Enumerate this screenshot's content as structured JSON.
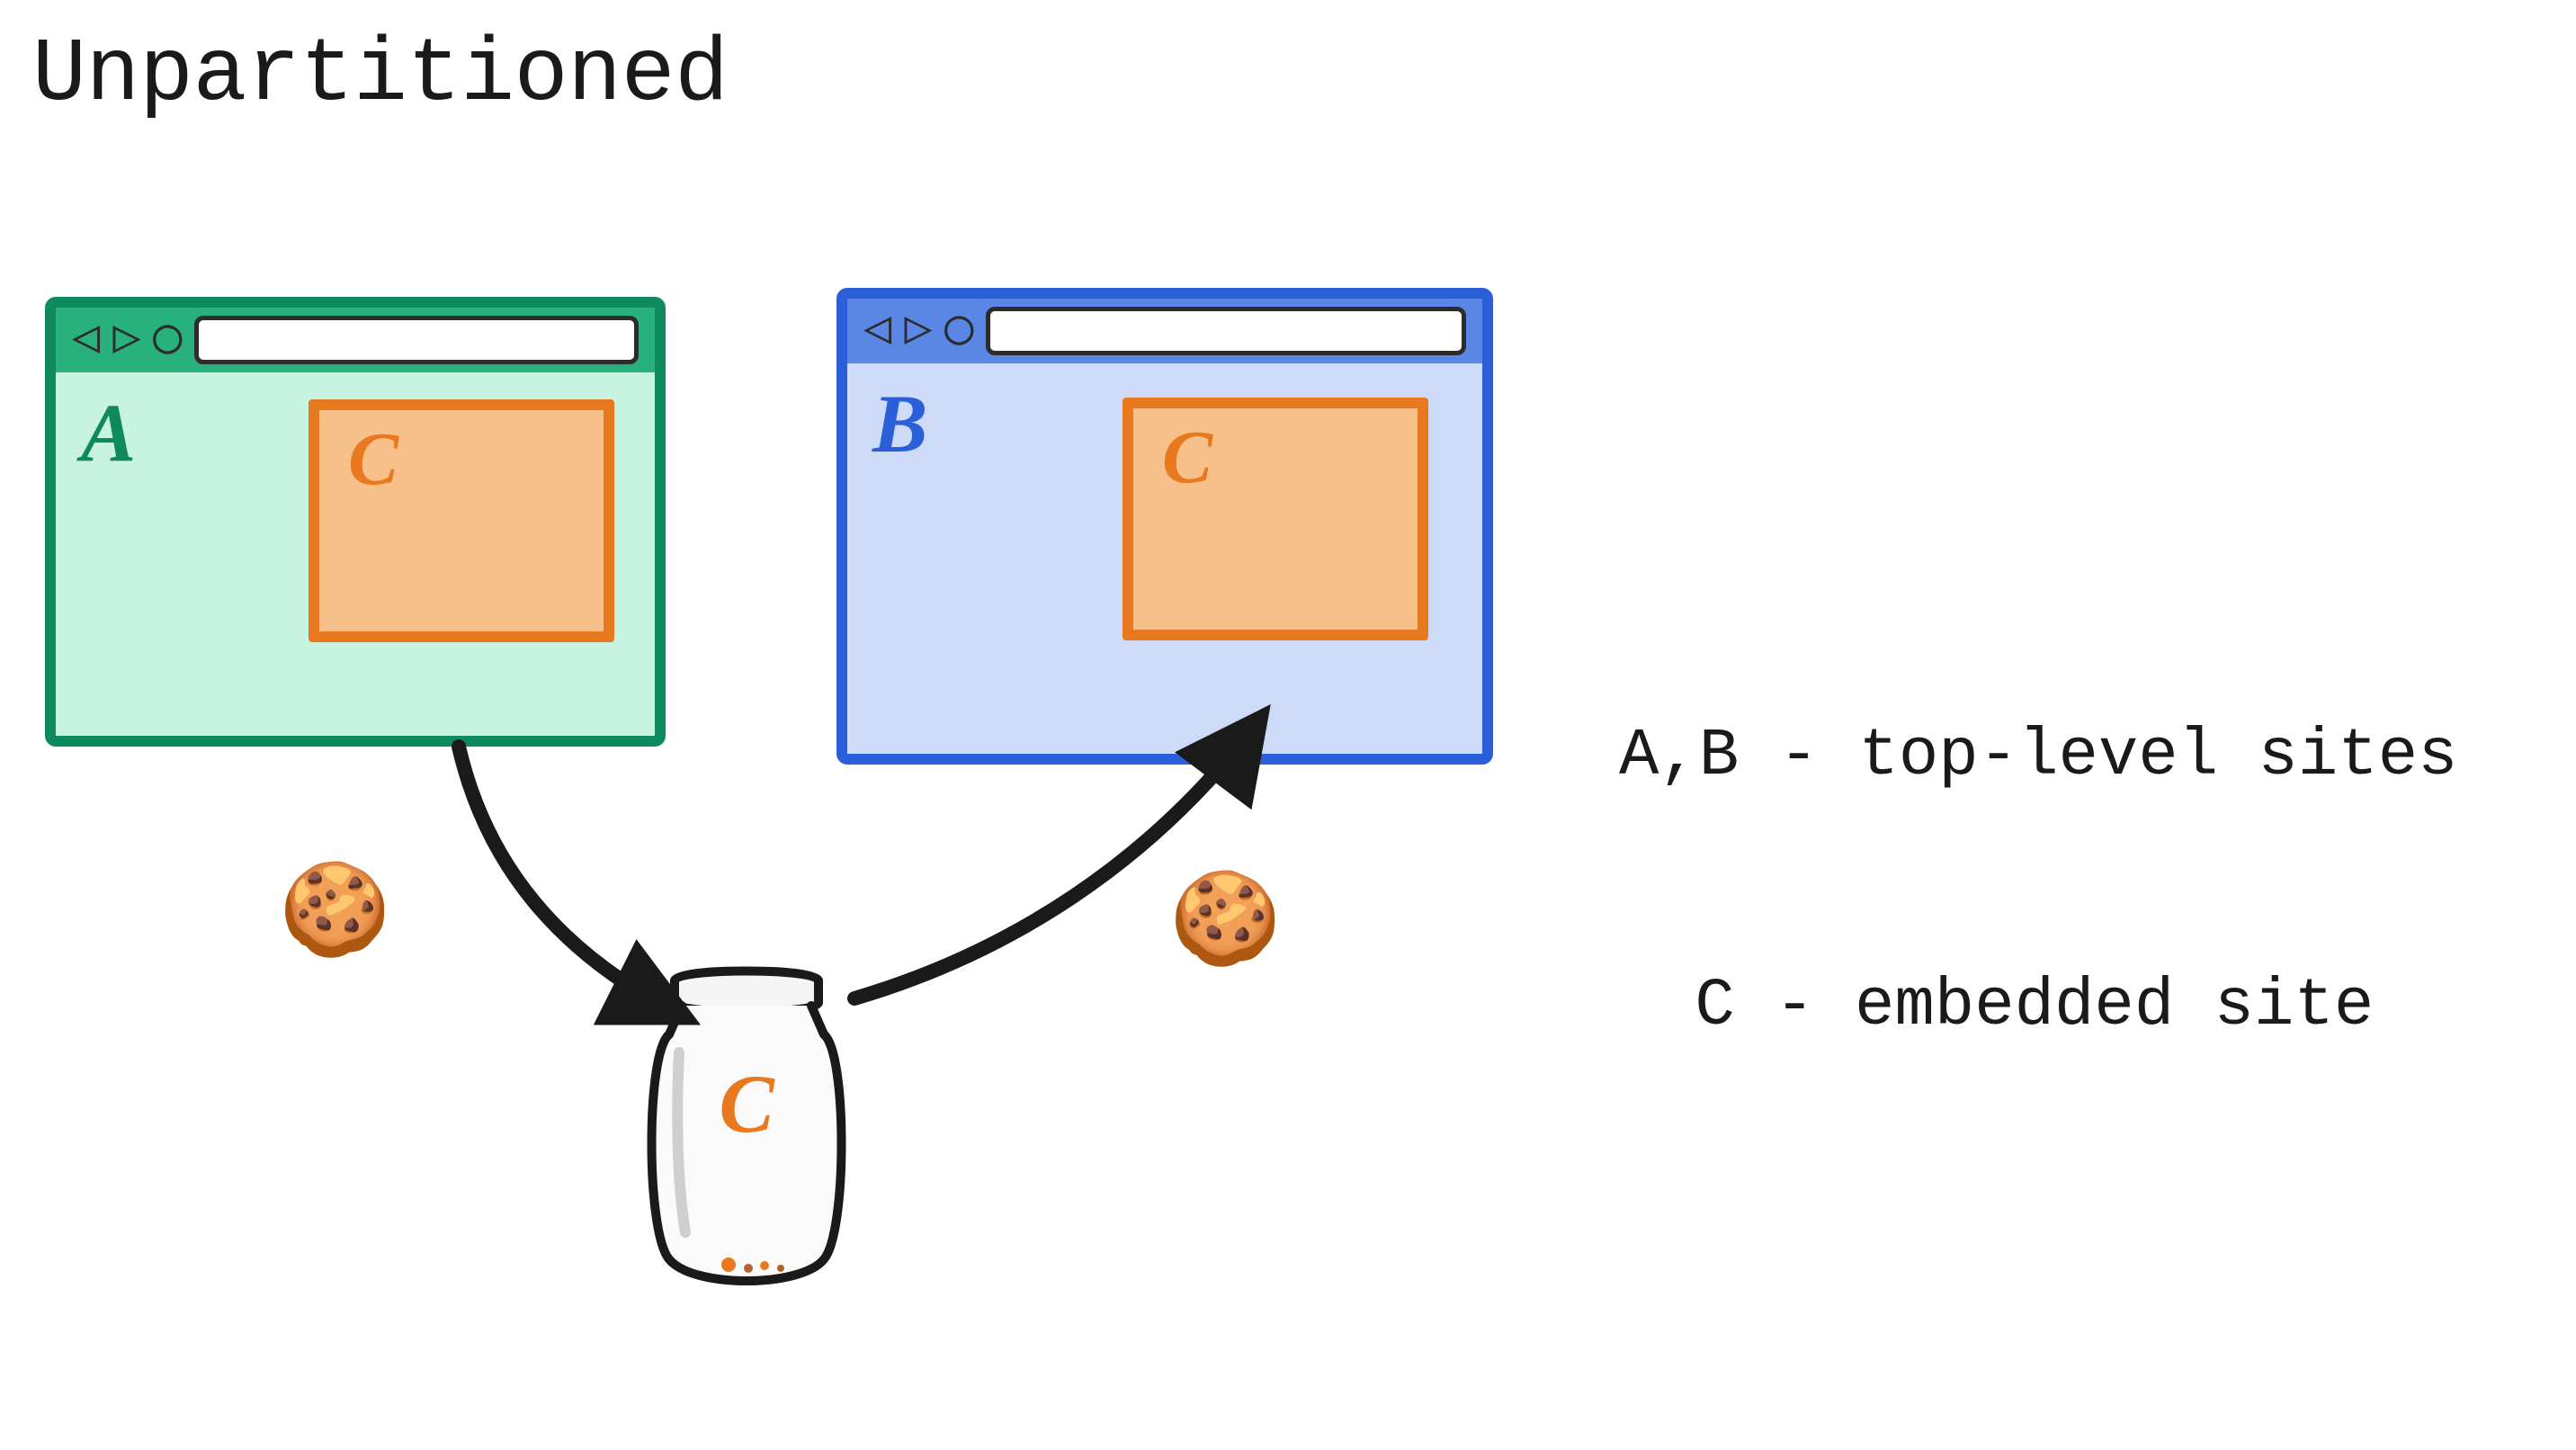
{
  "title": "Unpartitioned",
  "legend": {
    "line1": "A,B - top-level sites",
    "line2": "C - embedded site"
  },
  "windows": {
    "a": {
      "label": "A",
      "embed_label": "C"
    },
    "b": {
      "label": "B",
      "embed_label": "C"
    }
  },
  "nav_glyphs": {
    "back": "◁",
    "forward": "▷",
    "reload": "◯"
  },
  "jar_label": "C",
  "cookie_glyph": "🍪",
  "colors": {
    "site_a_border": "#0f8a5f",
    "site_a_fill": "#c8f3e1",
    "site_a_tab": "#28b07d",
    "site_b_border": "#2b5fd9",
    "site_b_fill": "#cddaf8",
    "site_b_tab": "#5a87e6",
    "embed_border": "#e8791e",
    "embed_fill": "#f7c08b",
    "arrow": "#1a1a1a"
  },
  "diagram": {
    "description": "Two browser windows A and B each embed site C. Both embedded Cs share a single unpartitioned cookie jar for C.",
    "top_level_sites": [
      "A",
      "B"
    ],
    "embedded_site": "C",
    "cookie_jar": {
      "owner": "C",
      "shared_across": [
        "A",
        "B"
      ]
    },
    "arrows": [
      {
        "from": "embed C in A",
        "to": "jar C",
        "meaning": "sets cookie"
      },
      {
        "from": "jar C",
        "to": "embed C in B",
        "meaning": "reads cookie"
      }
    ]
  }
}
